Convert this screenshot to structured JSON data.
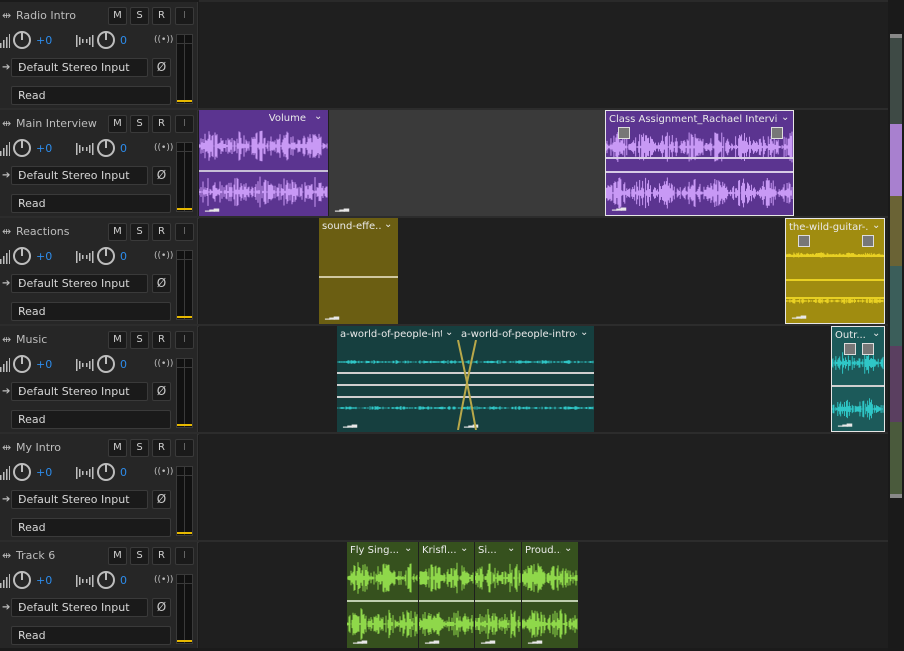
{
  "tracks": [
    {
      "name": "Radio Intro",
      "vol": "+0",
      "pan": "0",
      "input": "Default Stereo Input",
      "mode": "Read"
    },
    {
      "name": "Main Interview",
      "vol": "+0",
      "pan": "0",
      "input": "Default Stereo Input",
      "mode": "Read"
    },
    {
      "name": "Reactions",
      "vol": "+0",
      "pan": "0",
      "input": "Default Stereo Input",
      "mode": "Read"
    },
    {
      "name": "Music",
      "vol": "+0",
      "pan": "0",
      "input": "Default Stereo Input",
      "mode": "Read"
    },
    {
      "name": "My Intro",
      "vol": "+0",
      "pan": "0",
      "input": "Default Stereo Input",
      "mode": "Read"
    },
    {
      "name": "Track 6",
      "vol": "+0",
      "pan": "0",
      "input": "Default Stereo Input",
      "mode": "Read"
    }
  ],
  "buttons": {
    "mute": "M",
    "solo": "S",
    "record": "R",
    "input": "I"
  },
  "clips": {
    "volume": "Volume",
    "class_assignment": "Class Assignment_Rachael Interview ...",
    "sound_effect": "sound-effe...",
    "wild_guitar": "the-wild-guitar-...",
    "world_1": "a-world-of-people-intro-f...",
    "world_2": "a-world-of-people-intro-f...",
    "outro": "Outr...",
    "fly": "Fly Sing...",
    "krisfl": "Krisfl...",
    "si": "Si...",
    "proud": "Proud..."
  },
  "colors": {
    "purple": "#5b3490",
    "purple_wave": "#c899f5",
    "yellow": "#6b5e12",
    "yellow_wave": "#e8d023",
    "teal": "#163f3f",
    "teal_wave": "#2fc6c6",
    "green": "#36511e",
    "green_wave": "#8fd84a",
    "accent_blue": "#2d8ceb"
  }
}
